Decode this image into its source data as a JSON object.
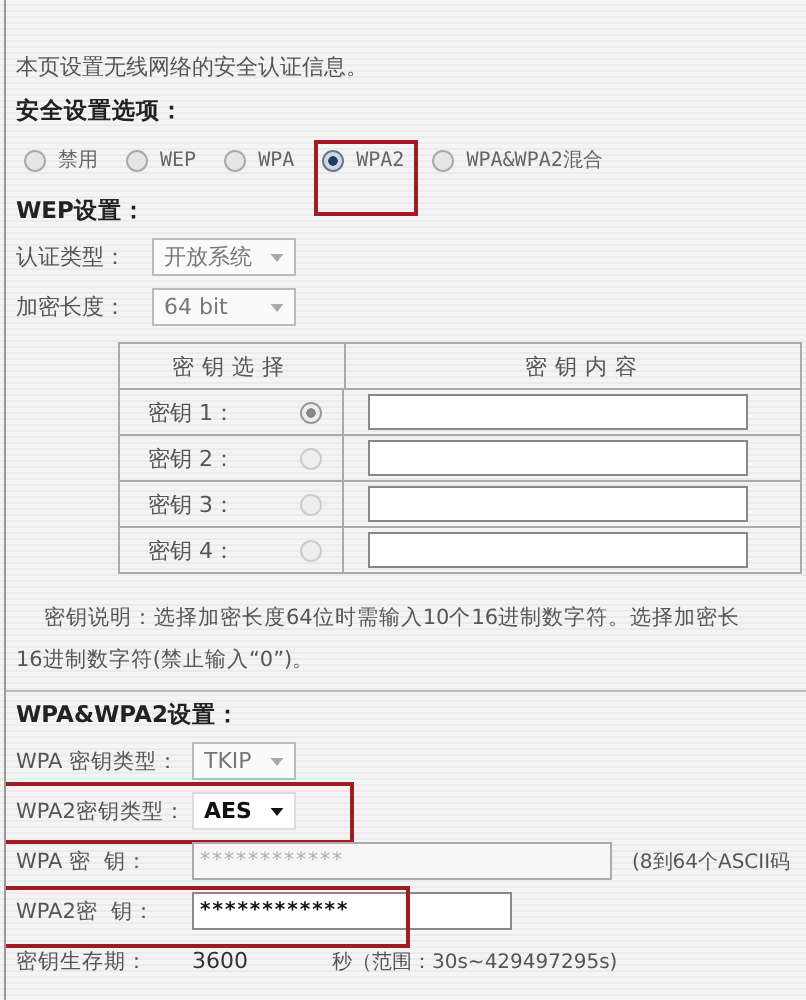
{
  "intro": "本页设置无线网络的安全认证信息。",
  "security_heading": "安全设置选项：",
  "security_options": [
    {
      "label": "禁用",
      "selected": false,
      "highlighted": false
    },
    {
      "label": "WEP",
      "selected": false,
      "highlighted": false
    },
    {
      "label": "WPA",
      "selected": false,
      "highlighted": false
    },
    {
      "label": "WPA2",
      "selected": true,
      "highlighted": true
    },
    {
      "label": "WPA&WPA2混合",
      "selected": false,
      "highlighted": false
    }
  ],
  "wep_heading": "WEP设置：",
  "wep_fields": [
    {
      "label": "认证类型：",
      "value": "开放系统"
    },
    {
      "label": "加密长度：",
      "value": "64 bit"
    }
  ],
  "key_table": {
    "columns": [
      "密钥选择",
      "密钥内容"
    ],
    "rows": [
      {
        "label": "密钥 1：",
        "selected": true
      },
      {
        "label": "密钥 2：",
        "selected": false
      },
      {
        "label": "密钥 3：",
        "selected": false
      },
      {
        "label": "密钥 4：",
        "selected": false
      }
    ]
  },
  "key_note": [
    "密钥说明：选择加密长度64位时需输入10个16进制数字符。选择加密长",
    "16进制数字符(禁止输入“0”)。"
  ],
  "wpa_heading": "WPA&WPA2设置：",
  "wpa_fields": [
    {
      "kind": "select",
      "label": "WPA 密钥类型：",
      "value": "TKIP",
      "disabled": true,
      "highlighted": false
    },
    {
      "kind": "select",
      "label": "WPA2密钥类型：",
      "value": "AES",
      "disabled": false,
      "highlighted": true
    },
    {
      "kind": "password",
      "label": "WPA 密  钥：",
      "value": "************",
      "disabled": true,
      "highlighted": false,
      "hint": "(8到64个ASCII码"
    },
    {
      "kind": "password",
      "label": "WPA2密  钥：",
      "value": "************",
      "disabled": false,
      "highlighted": true
    },
    {
      "kind": "text",
      "label": "密钥生存期：",
      "value": "3600",
      "highlighted": false,
      "hint": "秒（范围：30s~429497295s)"
    }
  ]
}
